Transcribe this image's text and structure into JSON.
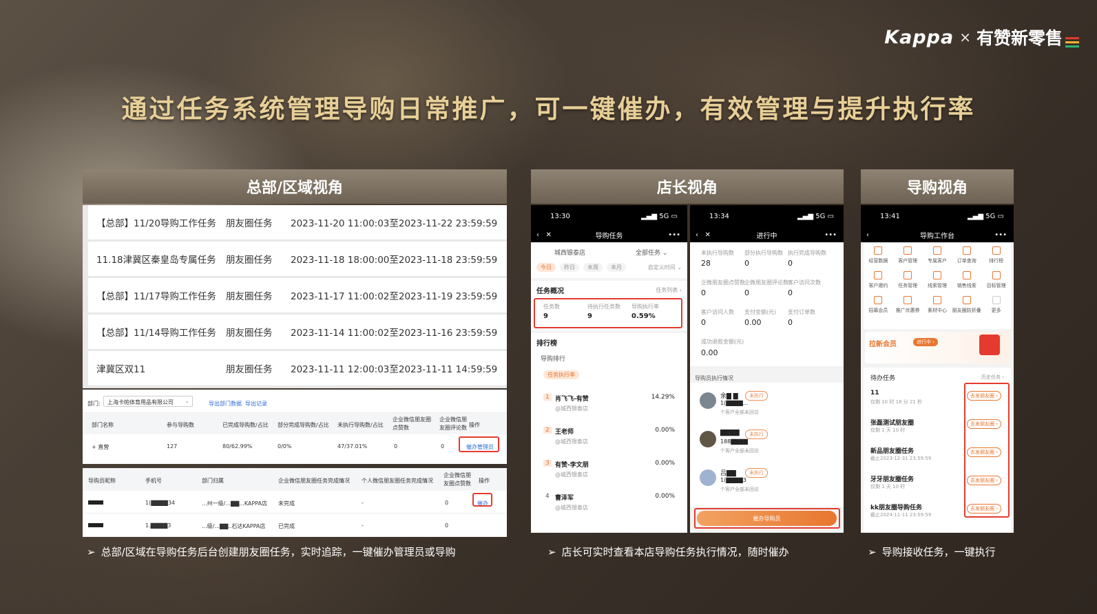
{
  "brand": {
    "kappa": "Kappa",
    "x": "×",
    "youzan": "有赞新零售",
    "bar_colors": [
      "#e53a2f",
      "#f7b32b",
      "#2bb673"
    ]
  },
  "title": "通过任务系统管理导购日常推广，可一键催办，有效管理与提升执行率",
  "sections": {
    "hq": "总部/区域视角",
    "store": "店长视角",
    "guide": "导购视角"
  },
  "hq_tasks": [
    {
      "name": "【总部】11/20导购工作任务",
      "type": "朋友圈任务",
      "time": "2023-11-20 11:00:03至2023-11-22 23:59:59"
    },
    {
      "name": "11.18津冀区秦皇岛专属任务",
      "type": "朋友圈任务",
      "time": "2023-11-18 18:00:00至2023-11-18 23:59:59"
    },
    {
      "name": "【总部】11/17导购工作任务",
      "type": "朋友圈任务",
      "time": "2023-11-17 11:00:02至2023-11-19 23:59:59"
    },
    {
      "name": "【总部】11/14导购工作任务",
      "type": "朋友圈任务",
      "time": "2023-11-14 11:00:02至2023-11-16 23:59:59"
    },
    {
      "name": "津冀区双11",
      "type": "朋友圈任务",
      "time": "2023-11-11 12:00:03至2023-11-11 14:59:59"
    }
  ],
  "dept_table": {
    "dept_label": "部门:",
    "dept_value": "上海卡帕体育用品有限公司",
    "export1": "导出部门数据",
    "export2": "导出记录",
    "headers": [
      "部门名称",
      "参与导购数",
      "已完成导购数/占比",
      "部分完成导购数/占比",
      "未执行导购数/占比",
      "企业微信朋友圈点赞数",
      "企业微信朋友圈评论数",
      "操作"
    ],
    "row": [
      "+ 直营",
      "127",
      "80/62.99%",
      "0/0%",
      "47/37.01%",
      "0",
      "0"
    ],
    "action": "催办管理员"
  },
  "guide_table": {
    "headers": [
      "导购员昵称",
      "手机号",
      "部门归属",
      "企业微信朋友圈任务完成情况",
      "个人微信朋友圈任务完成情况",
      "企业微信朋友圈点赞数",
      "操作"
    ],
    "rows": [
      {
        "phone": "1(▇▇▇▇34",
        "dept": "...州一级/...▇▇...KAPPA店",
        "status": "未完成",
        "personal": "-",
        "likes": "0",
        "action": "催办"
      },
      {
        "phone": "1.▇▇▇▇3",
        "dept": "...级/...▇▇..石达KAPPA店",
        "status": "已完成",
        "personal": "-",
        "likes": "0",
        "action": ""
      }
    ]
  },
  "phone1": {
    "time": "13:30",
    "signal": "5G",
    "nav_title": "导购任务",
    "store": "城西银泰店",
    "filter": "全部任务 ⌄",
    "date_tabs": [
      "今日",
      "昨日",
      "本周",
      "本月"
    ],
    "custom_time": "自定义时间 ⌄",
    "overview_title": "任务概况",
    "task_list": "任务列表 ›",
    "stats": [
      {
        "label": "任务数",
        "value": "9"
      },
      {
        "label": "待执行任务数",
        "value": "9"
      },
      {
        "label": "导购执行率",
        "value": "0.59%"
      }
    ],
    "rank_title": "排行榜",
    "rank_sub": "导购排行",
    "rank_tab": "任务执行率",
    "ranks": [
      {
        "no": "1",
        "name": "肖飞飞-有赞",
        "store": "@城西银泰店",
        "rate": "14.29%"
      },
      {
        "no": "2",
        "name": "王老师",
        "store": "@城西银泰店",
        "rate": "0.00%"
      },
      {
        "no": "3",
        "name": "有赞-李文朋",
        "store": "@城西银泰店",
        "rate": "0.00%"
      },
      {
        "no": "4",
        "name": "曹泽军",
        "store": "@城西银泰店",
        "rate": "0.00%"
      }
    ]
  },
  "phone2": {
    "time": "13:34",
    "signal": "5G",
    "nav_title": "进行中",
    "metrics": [
      {
        "label": "未执行导购数",
        "value": "28"
      },
      {
        "label": "部分执行导购数",
        "value": "0"
      },
      {
        "label": "执行完成导购数",
        "value": "0"
      },
      {
        "label": "企微朋友圈点赞数",
        "value": "0"
      },
      {
        "label": "企微朋友圈评论数",
        "value": "0"
      },
      {
        "label": "客户访问次数",
        "value": "0"
      },
      {
        "label": "客户访问人数",
        "value": "0"
      },
      {
        "label": "支付金额(元)",
        "value": "0.00"
      },
      {
        "label": "支付订单数",
        "value": "0"
      },
      {
        "label": "成功退款金额(元)",
        "value": "0.00"
      }
    ],
    "list_title": "导购员执行情况",
    "guides": [
      {
        "name": "余▇ ▇",
        "phone": "1(▇▇▇▇...",
        "tag": "未执行",
        "note": "个客户全部未回访"
      },
      {
        "name": "▇▇▇▇",
        "phone": "188▇▇▇▇",
        "tag": "未执行",
        "note": "个客户全部未回访"
      },
      {
        "name": "吕▇▇",
        "phone": "1(▇▇▇▇3",
        "tag": "未执行",
        "note": "个客户全部未回访"
      }
    ],
    "button": "催办导购员"
  },
  "phone3": {
    "time": "13:41",
    "signal": "5G",
    "nav_title": "导购工作台",
    "grid": [
      "经营数据",
      "客户管理",
      "专属客户",
      "订单查询",
      "排行榜",
      "客户邀约",
      "任务管理",
      "线索管理",
      "销售线索",
      "目标管理",
      "招募会员",
      "推广优惠券",
      "素材中心",
      "朋友圈防折叠",
      "更多"
    ],
    "banner": "拉新会员",
    "banner_pill": "进行中 ›",
    "todo_title": "待办任务",
    "history": "历史任务 ›",
    "todos": [
      {
        "name": "11",
        "sub": "仅剩 10 时 18 分 21 秒"
      },
      {
        "name": "张磊测试朋友圈",
        "sub": "仅剩 1 天 10 时"
      },
      {
        "name": "新品朋友圈任务",
        "sub": "截止2023-12-31 23:59:59"
      },
      {
        "name": "牙牙朋友圈任务",
        "sub": "仅剩 1 天 10 时"
      },
      {
        "name": "kk朋友圈导购任务",
        "sub": "截止2024-11-11 23:59:59"
      }
    ],
    "todo_button": "去发朋友圈 ›"
  },
  "notes": {
    "hq": "总部/区域在导购任务后台创建朋友圈任务，实时追踪，一键催办管理员或导购",
    "store": "店长可实时查看本店导购任务执行情况，随时催办",
    "guide": "导购接收任务，一键执行"
  },
  "accent": "#e53a2f"
}
